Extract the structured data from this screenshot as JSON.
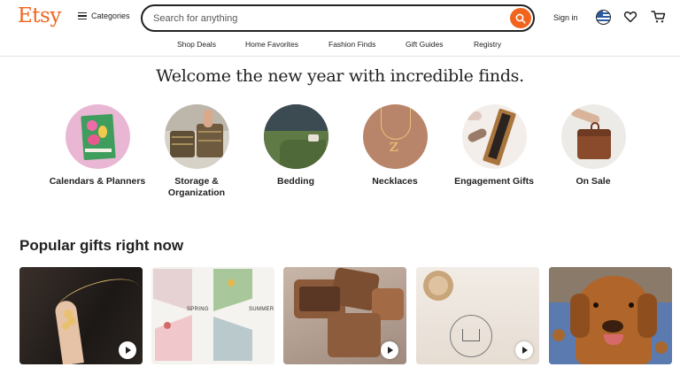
{
  "header": {
    "logo": "Etsy",
    "categories_label": "Categories",
    "search_placeholder": "Search for anything",
    "signin_label": "Sign in"
  },
  "subnav": {
    "items": [
      "Shop Deals",
      "Home Favorites",
      "Fashion Finds",
      "Gift Guides",
      "Registry"
    ]
  },
  "hero": {
    "title": "Welcome the new year with incredible finds.",
    "categories": [
      {
        "label": "Calendars & Planners"
      },
      {
        "label": "Storage & Organization"
      },
      {
        "label": "Bedding"
      },
      {
        "label": "Necklaces"
      },
      {
        "label": "Engagement Gifts"
      },
      {
        "label": "On Sale"
      }
    ]
  },
  "popular": {
    "title": "Popular gifts right now",
    "card2_labels": [
      "SPRING",
      "SUMMER"
    ]
  },
  "colors": {
    "brand": "#f1641e",
    "text": "#222222",
    "divider": "#e1e3df"
  },
  "icons": [
    "hamburger-icon",
    "search-icon",
    "globe-icon",
    "heart-icon",
    "cart-icon",
    "play-icon"
  ]
}
